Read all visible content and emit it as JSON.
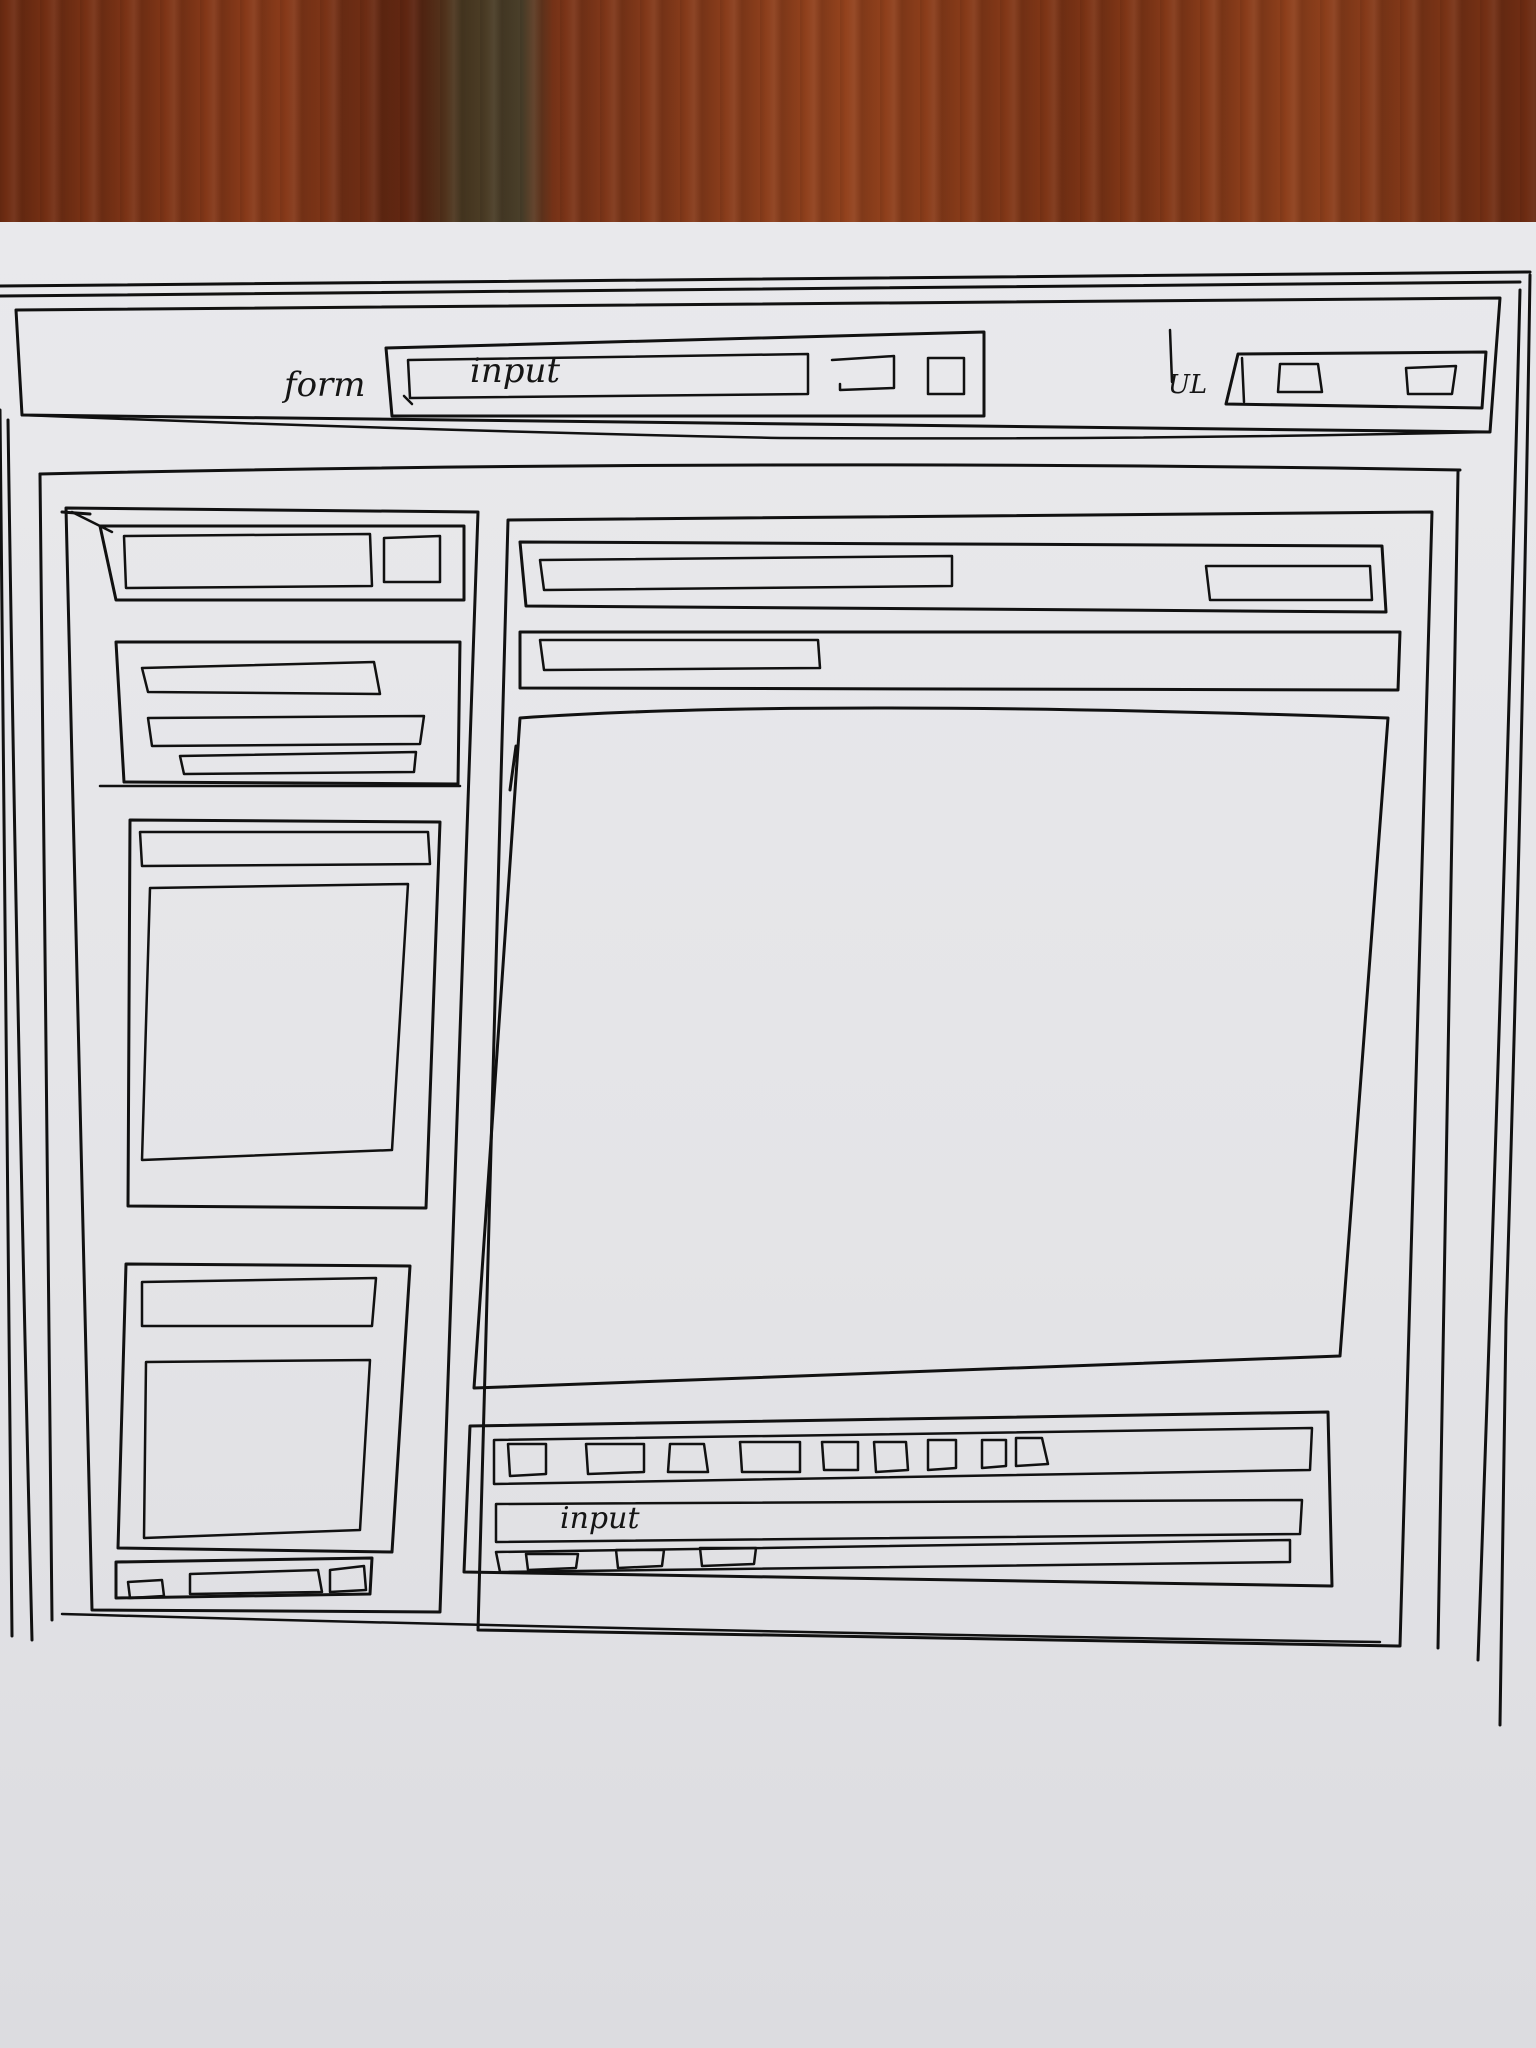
{
  "sketch": {
    "header": {
      "form_label": "form",
      "search_input": {
        "value": "input"
      },
      "right_label": "UL"
    },
    "main": {
      "composer": {
        "input": {
          "value": "input"
        }
      }
    }
  }
}
